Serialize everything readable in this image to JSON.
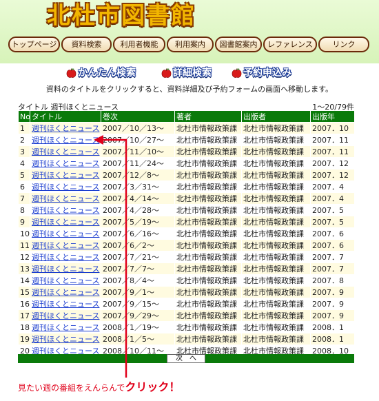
{
  "site": {
    "title": "北杜市図書館"
  },
  "nav": [
    {
      "label": "トップページ"
    },
    {
      "label": "資料検索"
    },
    {
      "label": "利用者機能"
    },
    {
      "label": "利用案内"
    },
    {
      "label": "図書館案内"
    },
    {
      "label": "レファレンス"
    },
    {
      "label": "リンク"
    }
  ],
  "search_links": [
    {
      "label": "かんたん検索",
      "icon": "apple-icon"
    },
    {
      "label": "詳細検索",
      "icon": "apple-icon"
    },
    {
      "label": "予約申込み",
      "icon": "apple-icon"
    }
  ],
  "instruction": "資料のタイトルをクリックすると、資料詳細及び予約フォームの画面へ移動します。",
  "results": {
    "title_line": "タイトル 週刊ほくとニュース",
    "count": "1～20/79件",
    "columns": [
      "No",
      "タイトル",
      "巻次",
      "著者",
      "出版者",
      "出版年"
    ],
    "rows": [
      {
        "no": "1",
        "title": "週刊ほくとニュース",
        "volume": "2007／10／13～",
        "author": "北杜市情報政策課",
        "publisher": "北杜市情報政策課",
        "year": "2007．10"
      },
      {
        "no": "2",
        "title": "週刊ほくとニュース",
        "volume": "2007／10／27～",
        "author": "北杜市情報政策課",
        "publisher": "北杜市情報政策課",
        "year": "2007．11"
      },
      {
        "no": "3",
        "title": "週刊ほくとニュース",
        "volume": "2007／11／10～",
        "author": "北杜市情報政策課",
        "publisher": "北杜市情報政策課",
        "year": "2007．11"
      },
      {
        "no": "4",
        "title": "週刊ほくとニュース",
        "volume": "2007／11／24～",
        "author": "北杜市情報政策課",
        "publisher": "北杜市情報政策課",
        "year": "2007．12"
      },
      {
        "no": "5",
        "title": "週刊ほくとニュース",
        "volume": "2007／12／8～",
        "author": "北杜市情報政策課",
        "publisher": "北杜市情報政策課",
        "year": "2007．12"
      },
      {
        "no": "6",
        "title": "週刊ほくとニュース",
        "volume": "2007／3／31～",
        "author": "北杜市情報政策課",
        "publisher": "北杜市情報政策課",
        "year": "2007．4"
      },
      {
        "no": "7",
        "title": "週刊ほくとニュース",
        "volume": "2007／4／14～",
        "author": "北杜市情報政策課",
        "publisher": "北杜市情報政策課",
        "year": "2007．4"
      },
      {
        "no": "8",
        "title": "週刊ほくとニュース",
        "volume": "2007／4／28～",
        "author": "北杜市情報政策課",
        "publisher": "北杜市情報政策課",
        "year": "2007．5"
      },
      {
        "no": "9",
        "title": "週刊ほくとニュース",
        "volume": "2007／5／19～",
        "author": "北杜市情報政策課",
        "publisher": "北杜市情報政策課",
        "year": "2007．5"
      },
      {
        "no": "10",
        "title": "週刊ほくとニュース",
        "volume": "2007／6／16～",
        "author": "北杜市情報政策課",
        "publisher": "北杜市情報政策課",
        "year": "2007．6"
      },
      {
        "no": "11",
        "title": "週刊ほくとニュース",
        "volume": "2007／6／2～",
        "author": "北杜市情報政策課",
        "publisher": "北杜市情報政策課",
        "year": "2007．6"
      },
      {
        "no": "12",
        "title": "週刊ほくとニュース",
        "volume": "2007／7／21～",
        "author": "北杜市情報政策課",
        "publisher": "北杜市情報政策課",
        "year": "2007．7"
      },
      {
        "no": "13",
        "title": "週刊ほくとニュース",
        "volume": "2007／7／7～",
        "author": "北杜市情報政策課",
        "publisher": "北杜市情報政策課",
        "year": "2007．7"
      },
      {
        "no": "14",
        "title": "週刊ほくとニュース",
        "volume": "2007／8／4～",
        "author": "北杜市情報政策課",
        "publisher": "北杜市情報政策課",
        "year": "2007．8"
      },
      {
        "no": "15",
        "title": "週刊ほくとニュース",
        "volume": "2007／9／1～",
        "author": "北杜市情報政策課",
        "publisher": "北杜市情報政策課",
        "year": "2007．9"
      },
      {
        "no": "16",
        "title": "週刊ほくとニュース",
        "volume": "2007／9／15～",
        "author": "北杜市情報政策課",
        "publisher": "北杜市情報政策課",
        "year": "2007．9"
      },
      {
        "no": "17",
        "title": "週刊ほくとニュース",
        "volume": "2007／9／29～",
        "author": "北杜市情報政策課",
        "publisher": "北杜市情報政策課",
        "year": "2007．9"
      },
      {
        "no": "18",
        "title": "週刊ほくとニュース",
        "volume": "2008／1／19～",
        "author": "北杜市情報政策課",
        "publisher": "北杜市情報政策課",
        "year": "2008．1"
      },
      {
        "no": "19",
        "title": "週刊ほくとニュース",
        "volume": "2008／1／5～",
        "author": "北杜市情報政策課",
        "publisher": "北杜市情報政策課",
        "year": "2008．1"
      },
      {
        "no": "20",
        "title": "週刊ほくとニュース",
        "volume": "2008／10／11～",
        "author": "北杜市情報政策課",
        "publisher": "北杜市情報政策課",
        "year": "2008．10"
      }
    ],
    "next_label": "次　へ"
  },
  "annotation": {
    "text": "見たい週の番組をえんらんで",
    "emphasis": "クリック！",
    "color": "#e0001a"
  },
  "colors": {
    "header_bg": "#dff5c6",
    "table_header": "#0a7a0a",
    "link": "#1a3ccf",
    "logo": "#f2b600"
  }
}
